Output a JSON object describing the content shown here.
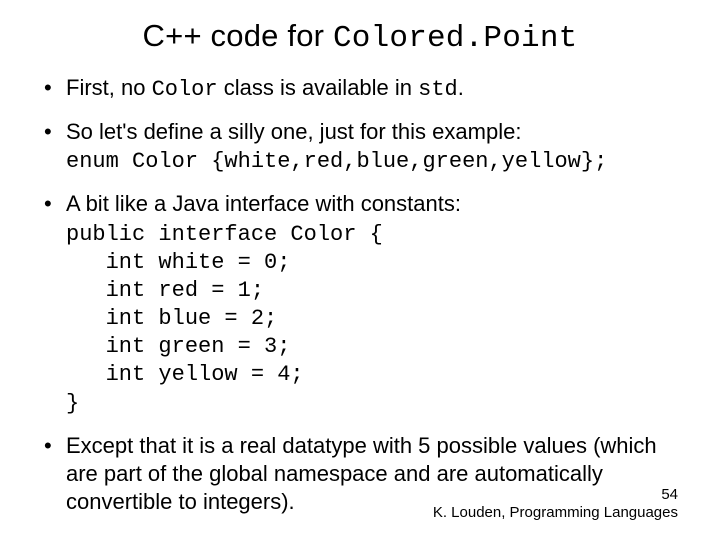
{
  "title": {
    "pre": "C++ code for ",
    "mono": "Colored.Point"
  },
  "bullets": {
    "b1": {
      "t1": "First, no ",
      "m1": "Color",
      "t2": " class is available in ",
      "m2": "std",
      "t3": "."
    },
    "b2": {
      "t1": "So let's define a silly one, just for this example:",
      "code": "enum Color {white,red,blue,green,yellow};"
    },
    "b3": {
      "t1": "A bit like a Java interface with constants:",
      "code": "public interface Color {\n   int white = 0;\n   int red = 1;\n   int blue = 2;\n   int green = 3;\n   int yellow = 4;\n}"
    },
    "b4": {
      "t1": "Except that it is a real datatype with 5 possible values (which are part of the global namespace and are automatically convertible to integers)."
    }
  },
  "footer": {
    "page": "54",
    "credit": "K. Louden, Programming Languages"
  }
}
